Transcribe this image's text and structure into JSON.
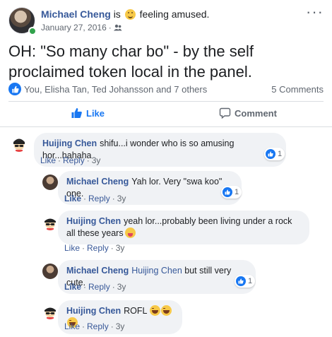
{
  "post": {
    "author": "Michael Cheng",
    "is_text": "is",
    "feeling": "feeling amused.",
    "date": "January 27, 2016",
    "privacy_icon": "friends-icon",
    "more_icon": "more-options-icon",
    "text": "OH: \"So many char bo\" - by the self proclaimed token local in the panel.",
    "reactors": "You, Elisha Tan, Ted Johansson and 7 others",
    "comments_count": "5 Comments",
    "like_label": "Like",
    "comment_label": "Comment"
  },
  "comments": [
    {
      "author": "Huijing Chen",
      "text": "shifu...i wonder who is so amusing hor...hahaha",
      "like": "Like",
      "reply": "Reply",
      "time": "3y",
      "reactions": "1"
    },
    {
      "author": "Michael Cheng",
      "text": "Yah lor. Very \"swa koo\" one.",
      "like": "Like",
      "reply": "Reply",
      "time": "3y",
      "reactions": "1"
    },
    {
      "author": "Huijing Chen",
      "text": "yeah lor...probably been living under a rock all these years",
      "like": "Like",
      "reply": "Reply",
      "time": "3y"
    },
    {
      "author": "Michael Cheng",
      "mention": "Huijing Chen",
      "text": "but still very cute.",
      "like": "Like",
      "reply": "Reply",
      "time": "3y",
      "reactions": "1"
    },
    {
      "author": "Huijing Chen",
      "text": "ROFL",
      "like": "Like",
      "reply": "Reply",
      "time": "3y"
    }
  ],
  "colors": {
    "accent": "#1877f2",
    "link": "#365899",
    "bubble": "#f0f2f5",
    "online": "#31a24c"
  }
}
